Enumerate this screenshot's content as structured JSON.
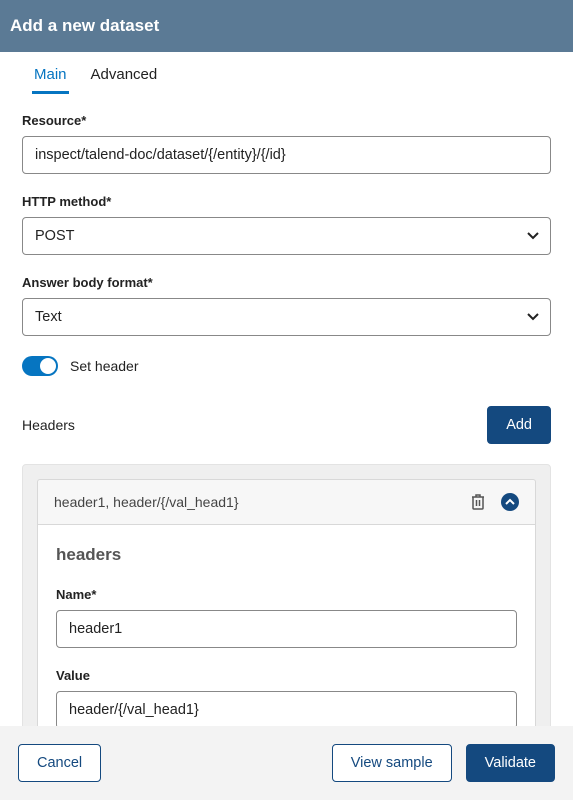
{
  "header": {
    "title": "Add a new dataset"
  },
  "tabs": {
    "main": "Main",
    "advanced": "Advanced",
    "active": "main"
  },
  "form": {
    "resource": {
      "label": "Resource*",
      "value": "inspect/talend-doc/dataset/{/entity}/{/id}"
    },
    "http_method": {
      "label": "HTTP method*",
      "value": "POST"
    },
    "answer_body": {
      "label": "Answer body format*",
      "value": "Text"
    },
    "set_header": {
      "label": "Set header",
      "on": true
    }
  },
  "headers_section": {
    "label": "Headers",
    "add_label": "Add",
    "card": {
      "summary": "header1, header/{/val_head1}",
      "title": "headers",
      "name": {
        "label": "Name*",
        "value": "header1"
      },
      "value": {
        "label": "Value",
        "value": "header/{/val_head1}"
      }
    }
  },
  "footer": {
    "cancel": "Cancel",
    "view_sample": "View sample",
    "validate": "Validate"
  }
}
